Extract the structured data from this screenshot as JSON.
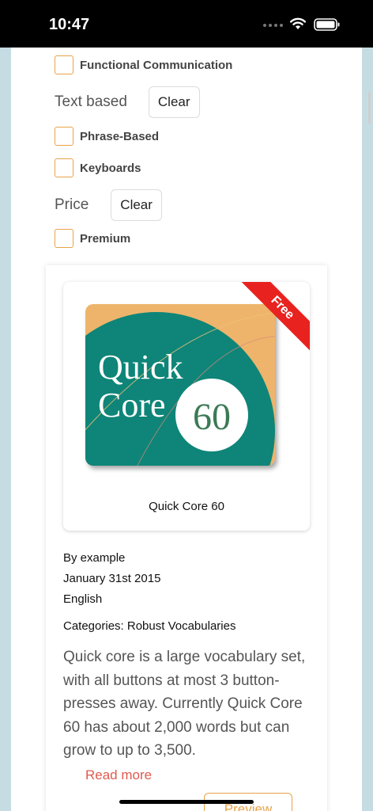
{
  "status_bar": {
    "time": "10:47"
  },
  "filters": {
    "items_top": [
      {
        "label": "Functional Communication"
      }
    ],
    "text_based": {
      "title": "Text based",
      "clear_label": "Clear",
      "items": [
        {
          "label": "Phrase-Based"
        },
        {
          "label": "Keyboards"
        }
      ]
    },
    "price": {
      "title": "Price",
      "clear_label": "Clear",
      "items": [
        {
          "label": "Premium"
        }
      ]
    }
  },
  "product": {
    "badge": "Free",
    "cover_text_line1": "Quick",
    "cover_text_line2": "Core",
    "cover_number": "60",
    "title": "Quick Core 60",
    "author": "By example",
    "date": "January 31st 2015",
    "language": "English",
    "categories": "Categories: Robust Vocabularies",
    "description": "Quick core is a large vocabulary set, with all buttons at most 3 button-presses away. Currently Quick Core 60 has about 2,000 words but can grow to up to 3,500.",
    "read_more": "Read more",
    "preview_label": "Preview"
  },
  "colors": {
    "accent_orange": "#e8a34a",
    "cover_teal": "#0e8578",
    "cover_orange": "#eeb46b",
    "ribbon_red": "#e8221f",
    "read_more_red": "#e05a4e"
  }
}
